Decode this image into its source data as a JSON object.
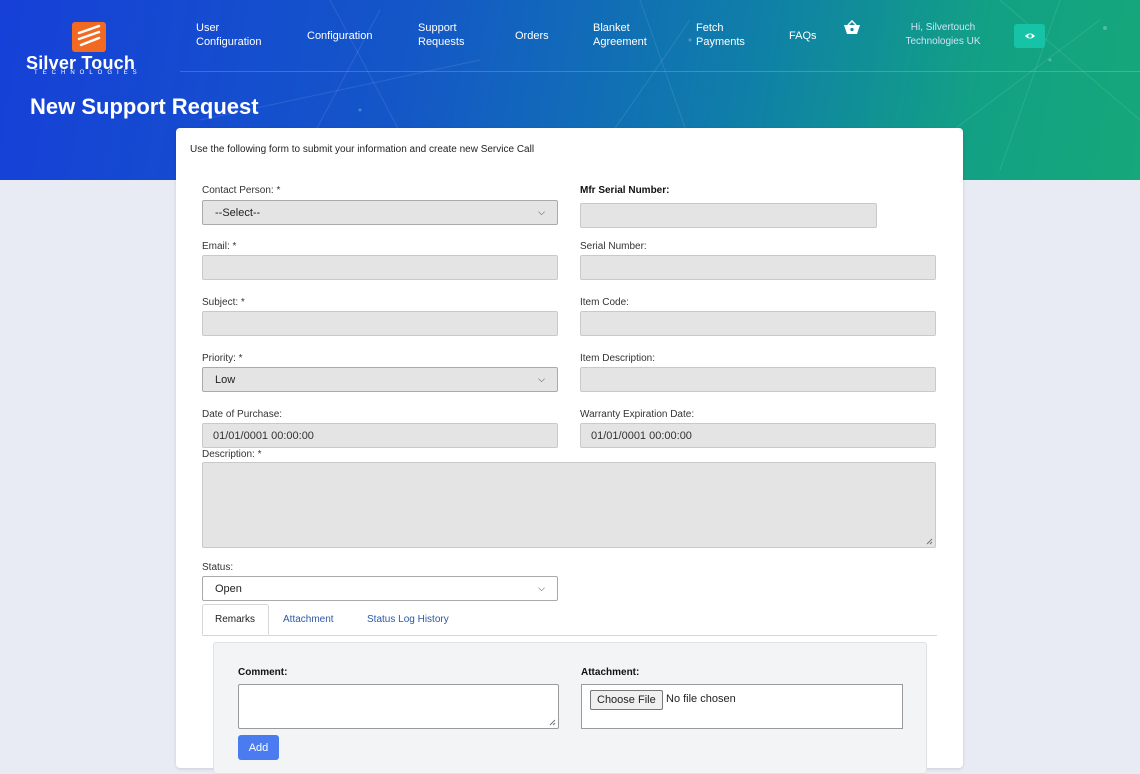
{
  "brand": {
    "name": "Silver Touch",
    "tagline": "TECHNOLOGIES"
  },
  "nav": {
    "items": [
      {
        "label": "User Configuration"
      },
      {
        "label": "Configuration"
      },
      {
        "label": "Support Requests"
      },
      {
        "label": "Orders"
      },
      {
        "label": "Blanket Agreement"
      },
      {
        "label": "Fetch Payments"
      },
      {
        "label": "FAQs"
      }
    ],
    "greeting": "Hi, Silvertouch Technologies UK",
    "cart_icon": "basket-icon",
    "eye_icon": "eye-icon"
  },
  "page": {
    "title": "New Support Request"
  },
  "form": {
    "intro": "Use the following form to submit your information and create new Service Call",
    "contact_person": {
      "label": "Contact Person: *",
      "value": "--Select--"
    },
    "mfr_serial": {
      "label": "Mfr Serial Number:",
      "value": ""
    },
    "email": {
      "label": "Email: *",
      "value": ""
    },
    "serial_number": {
      "label": "Serial Number:",
      "value": ""
    },
    "subject": {
      "label": "Subject: *",
      "value": ""
    },
    "item_code": {
      "label": "Item Code:",
      "value": ""
    },
    "priority": {
      "label": "Priority: *",
      "value": "Low"
    },
    "item_description": {
      "label": "Item Description:",
      "value": ""
    },
    "date_of_purchase": {
      "label": "Date of Purchase:",
      "value": "01/01/0001 00:00:00"
    },
    "warranty_expiration": {
      "label": "Warranty Expiration Date:",
      "value": "01/01/0001 00:00:00"
    },
    "description": {
      "label": "Description: *",
      "value": ""
    },
    "status": {
      "label": "Status:",
      "value": "Open"
    }
  },
  "tabs": [
    {
      "label": "Remarks",
      "active": true
    },
    {
      "label": "Attachment",
      "active": false
    },
    {
      "label": "Status Log History",
      "active": false
    }
  ],
  "remarks": {
    "comment_label": "Comment:",
    "attachment_label": "Attachment:",
    "choose_file": "Choose File",
    "no_file": "No file chosen",
    "add_label": "Add"
  },
  "colors": {
    "hero_start": "#1640d8",
    "hero_end": "#16a77a",
    "logo_orange": "#f26a21",
    "accent_teal": "#17c3a7",
    "add_button": "#4a7cf0",
    "link_blue": "#2a5aa8"
  }
}
